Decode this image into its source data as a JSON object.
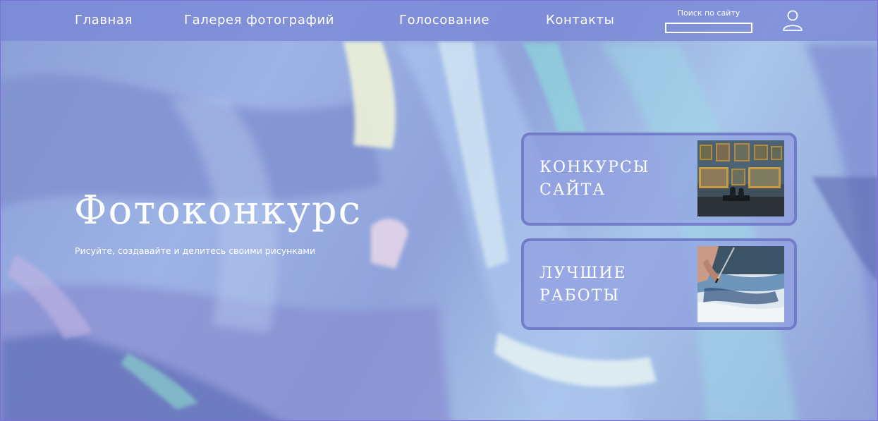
{
  "nav": {
    "home": "Главная",
    "gallery": "Галерея фотографий",
    "voting": "Голосование",
    "contacts": "Контакты"
  },
  "search": {
    "label": "Поиск по сайту",
    "value": ""
  },
  "user": {
    "icon": "user-icon"
  },
  "hero": {
    "title": "Фотоконкурс",
    "subtitle": "Рисуйте, создавайте и делитесь своими рисунками"
  },
  "cards": [
    {
      "line1": "КОНКУРСЫ",
      "line2": "САЙТА",
      "image": "gallery-hall-photo"
    },
    {
      "line1": "ЛУЧШИЕ",
      "line2": "РАБОТЫ",
      "image": "watercolor-painting-photo"
    }
  ],
  "colors": {
    "nav_bar": "#7886d6",
    "card_border": "#6c76c4",
    "text": "#ffffff",
    "page_border": "#7e6fd6"
  }
}
